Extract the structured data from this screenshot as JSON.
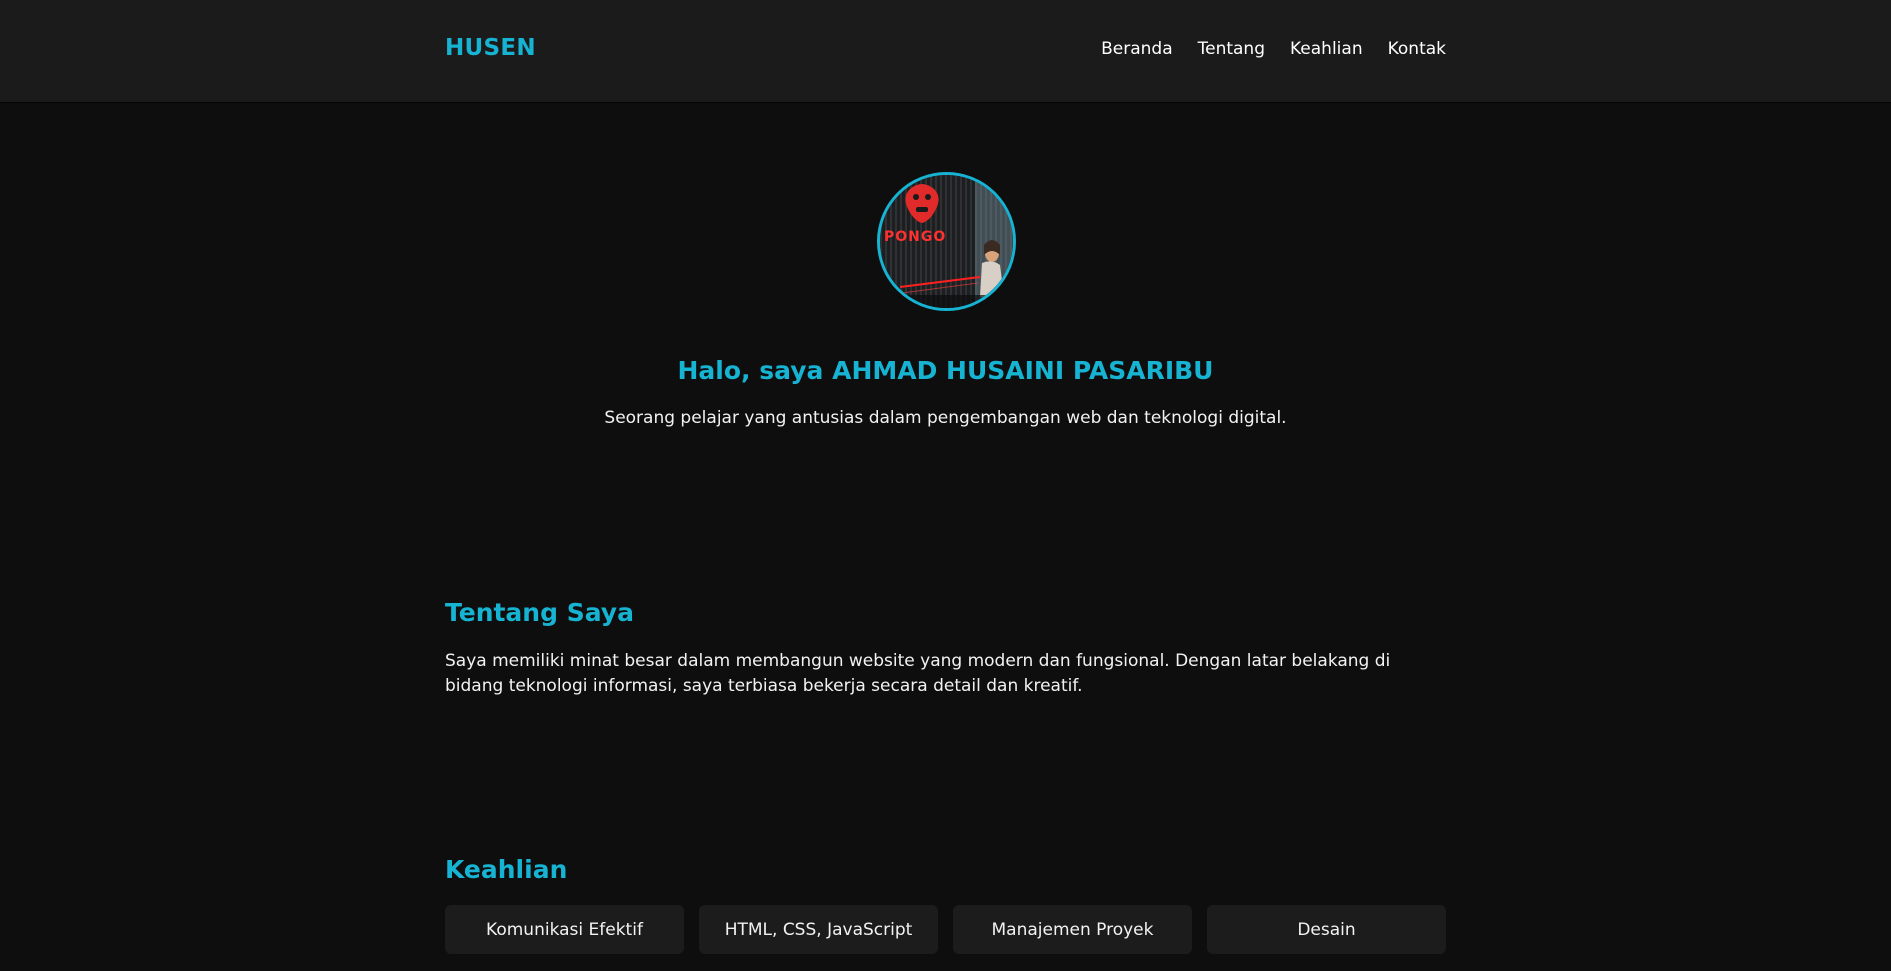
{
  "header": {
    "brand": "HUSEN",
    "nav": [
      "Beranda",
      "Tentang",
      "Keahlian",
      "Kontak"
    ]
  },
  "hero": {
    "avatar_sign_text": "PONGO",
    "title": "Halo, saya AHMAD HUSAINI PASARIBU",
    "subtitle": "Seorang pelajar yang antusias dalam pengembangan web dan teknologi digital."
  },
  "about": {
    "title": "Tentang Saya",
    "text": "Saya memiliki minat besar dalam membangun website yang modern dan fungsional. Dengan latar belakang di bidang teknologi informasi, saya terbiasa bekerja secara detail dan kreatif."
  },
  "skills": {
    "title": "Keahlian",
    "items": [
      "Komunikasi Efektif",
      "HTML, CSS, JavaScript",
      "Manajemen Proyek",
      "Desain"
    ]
  },
  "colors": {
    "accent": "#16b3d2",
    "header_bg": "#1b1b1b",
    "page_bg": "#0e0e0e",
    "card_bg": "#1c1c1c"
  }
}
